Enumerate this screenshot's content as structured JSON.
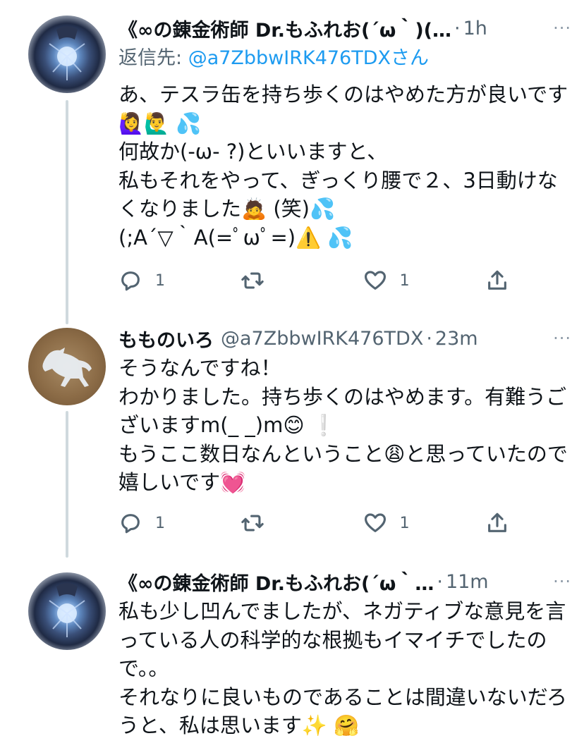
{
  "tweets": [
    {
      "name": "《∞の錬金術師 Dr.もふれお(´ω｀)(…",
      "time": "1h",
      "more": "···",
      "reply_prefix": "返信先: ",
      "reply_to": "@a7ZbbwIRK476TDXさん",
      "text": "あ、テスラ缶を持ち歩くのはやめた方が良いです🙋‍♀️🙋‍♂️ 💦\n何故か(-ω- ?)といいますと、\n私もそれをやって、ぎっくり腰で２、3日動けなくなりました🙇 (笑)💦\n(;A´▽｀A(=ﾟωﾟ=)⚠️ 💦",
      "reply_count": "1",
      "like_count": "1"
    },
    {
      "name": "もものいろ",
      "handle": "@a7ZbbwIRK476TDX",
      "time": "23m",
      "more": "···",
      "text": "そうなんですね！\nわかりました。持ち歩くのはやめます。有難うございますm(_ _)m😊 ❕\nもうここ数日なんということ😩と思っていたので嬉しいです💓",
      "reply_count": "1",
      "like_count": "1"
    },
    {
      "name": "《∞の錬金術師 Dr.もふれお(´ω｀…",
      "time": "11m",
      "more": "···",
      "text": "私も少し凹んでましたが、ネガティブな意見を言っている人の科学的な根拠もイマイチでしたので。。\nそれなりに良いものであることは間違いないだろうと、私は思います✨ 🤗"
    }
  ]
}
